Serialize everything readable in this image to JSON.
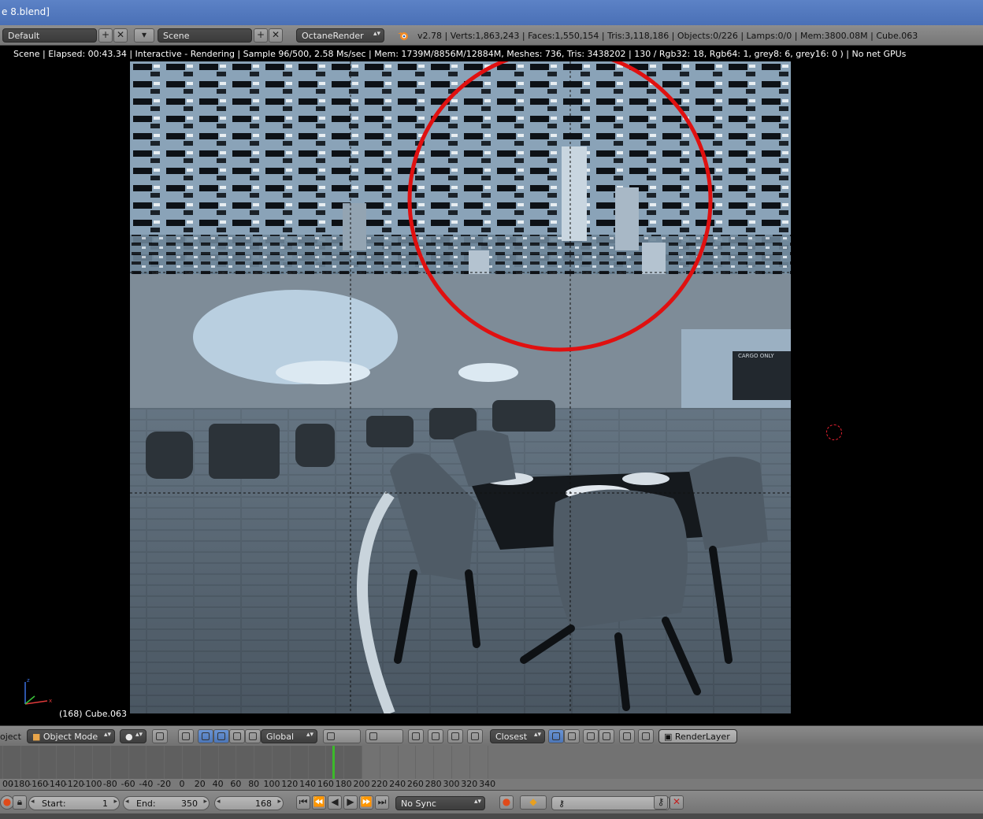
{
  "window": {
    "title": "e 8.blend]"
  },
  "info_header": {
    "layout": "Default",
    "scene": "Scene",
    "render_engine": "OctaneRender",
    "stats": "v2.78 | Verts:1,863,243 | Faces:1,550,154 | Tris:3,118,186 | Objects:0/226 | Lamps:0/0 | Mem:3800.08M | Cube.063",
    "add_icon": "plus-icon",
    "close_icon": "x-icon"
  },
  "viewport": {
    "status": "Scene | Elapsed: 00:43.34 | Interactive - Rendering | Sample 96/500, 2.58 Ms/sec | Mem: 1739M/8856M/12884M, Meshes: 736, Tris: 3438202 | 130 / Rgb32: 18, Rgb64: 1, grey8: 6, grey16: 0 ) | No net GPUs",
    "object_label": "(168) Cube.063",
    "sign_text": "CARGO ONLY",
    "annotation_color": "#e01010"
  },
  "view_header": {
    "editor_label": "oject",
    "mode": "Object Mode",
    "orientation": "Global",
    "snap_target": "Closest",
    "render_layer": "RenderLayer"
  },
  "timeline": {
    "ticks": [
      "00",
      "-180",
      "-160",
      "-140",
      "-120",
      "-100",
      "-80",
      "-60",
      "-40",
      "-20",
      "0",
      "20",
      "40",
      "60",
      "80",
      "100",
      "120",
      "140",
      "160",
      "180",
      "200",
      "220",
      "240",
      "260",
      "280",
      "300",
      "320",
      "340"
    ],
    "current_frame_marker": 168
  },
  "playback": {
    "start_label": "Start:",
    "start_value": "1",
    "end_label": "End:",
    "end_value": "350",
    "current_value": "168",
    "sync": "No Sync"
  },
  "colors": {
    "accent": "#5c82c6",
    "playhead": "#3cba2a",
    "record": "#e04a1a"
  }
}
